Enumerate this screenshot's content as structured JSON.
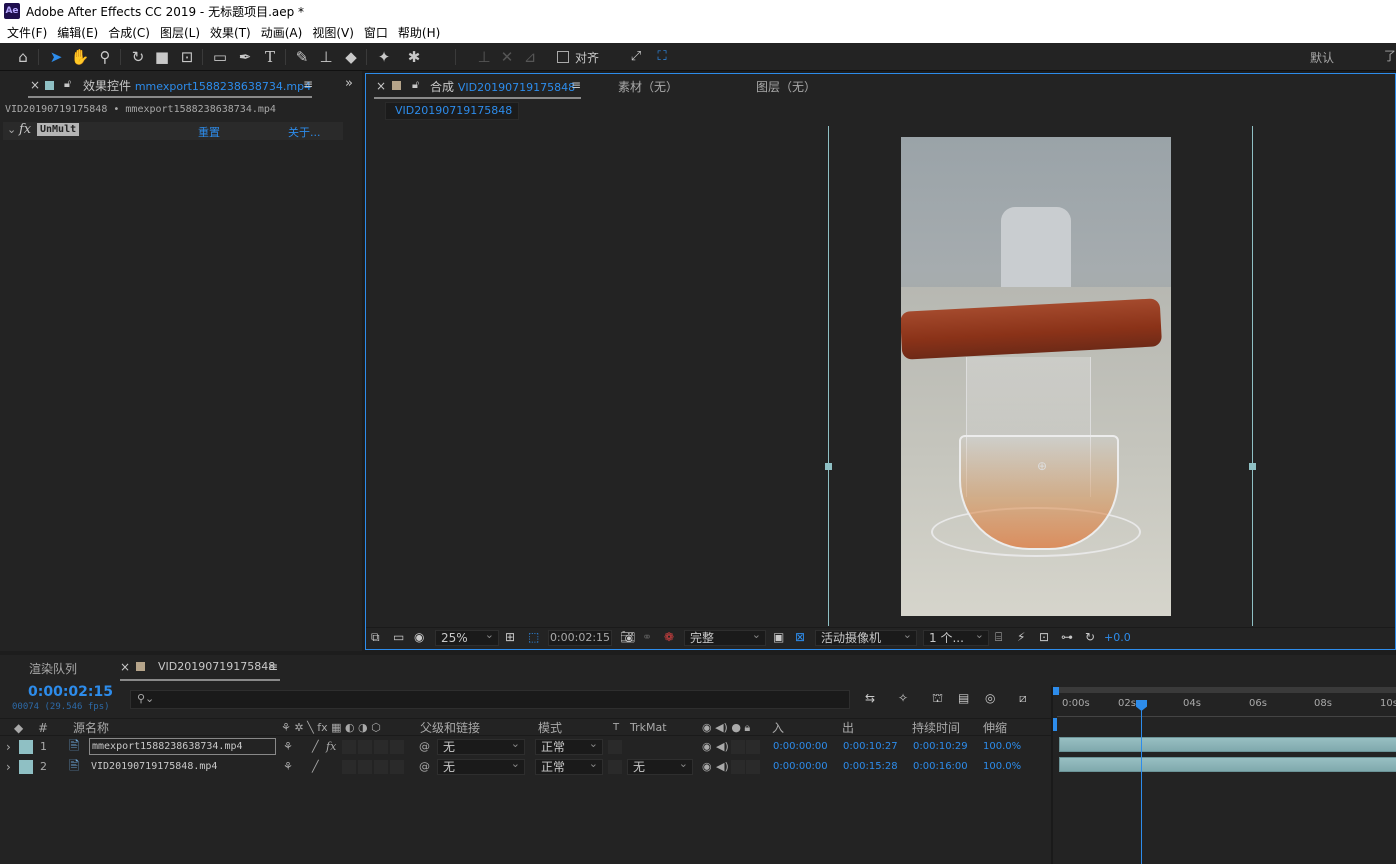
{
  "window": {
    "title": "Adobe After Effects CC 2019 - 无标题项目.aep *",
    "logo": "Ae"
  },
  "menu": [
    "文件(F)",
    "编辑(E)",
    "合成(C)",
    "图层(L)",
    "效果(T)",
    "动画(A)",
    "视图(V)",
    "窗口",
    "帮助(H)"
  ],
  "toolbar": {
    "snap_label": "对齐",
    "workspace": "默认",
    "icons": [
      "home-icon",
      "selection-tool-icon",
      "hand-tool-icon",
      "zoom-tool-icon",
      "rotate-tool-icon",
      "camera-tool-icon",
      "pan-behind-tool-icon",
      "rectangle-tool-icon",
      "pen-tool-icon",
      "type-tool-icon",
      "brush-tool-icon",
      "clone-stamp-tool-icon",
      "eraser-tool-icon",
      "roto-brush-tool-icon",
      "puppet-pin-tool-icon"
    ]
  },
  "effect_controls": {
    "tab_prefix": "效果控件",
    "tab_layer": "mmexport1588238638734.mp4",
    "breadcrumb": "VID20190719175848 • mmexport1588238638734.mp4",
    "effect": {
      "fx_label": "fx",
      "name": "UnMult",
      "reset": "重置",
      "about": "关于..."
    }
  },
  "composition_panel": {
    "tab_prefix": "合成",
    "tab_name": "VID20190719175848",
    "footage_tab": "素材（无）",
    "layer_tab": "图层（无）",
    "subtab": "VID20190719175848",
    "footer": {
      "zoom": "25%",
      "timecode": "0:00:02:15",
      "resolution": "完整",
      "camera": "活动摄像机",
      "views": "1 个...",
      "exposure": "+0.0"
    }
  },
  "timeline": {
    "render_queue_tab": "渲染队列",
    "comp_tab": "VID20190719175848",
    "current_time": "0:00:02:15",
    "frame_info": "00074 (29.546 fps)",
    "search_placeholder": "",
    "columns": {
      "num": "#",
      "source_name": "源名称",
      "parent": "父级和链接",
      "mode": "模式",
      "t": "T",
      "trkmat": "TrkMat",
      "in": "入",
      "out": "出",
      "duration": "持续时间",
      "stretch": "伸缩"
    },
    "layers": [
      {
        "num": "1",
        "name": "mmexport1588238638734.mp4",
        "parent": "无",
        "mode": "正常",
        "trkmat": "",
        "in": "0:00:00:00",
        "out": "0:00:10:27",
        "duration": "0:00:10:29",
        "stretch": "100.0%",
        "has_fx": true,
        "color": "#8fc0c4"
      },
      {
        "num": "2",
        "name": "VID20190719175848.mp4",
        "parent": "无",
        "mode": "正常",
        "trkmat": "无",
        "in": "0:00:00:00",
        "out": "0:00:15:28",
        "duration": "0:00:16:00",
        "stretch": "100.0%",
        "has_fx": false,
        "color": "#8fc0c4"
      }
    ],
    "ruler": [
      "0:00s",
      "02s",
      "04s",
      "06s",
      "08s",
      "10s"
    ],
    "playhead_seconds": 2.5
  },
  "colors": {
    "accent": "#2d8ceb",
    "label": "#8fc0c4",
    "panel_bg": "#232323"
  }
}
